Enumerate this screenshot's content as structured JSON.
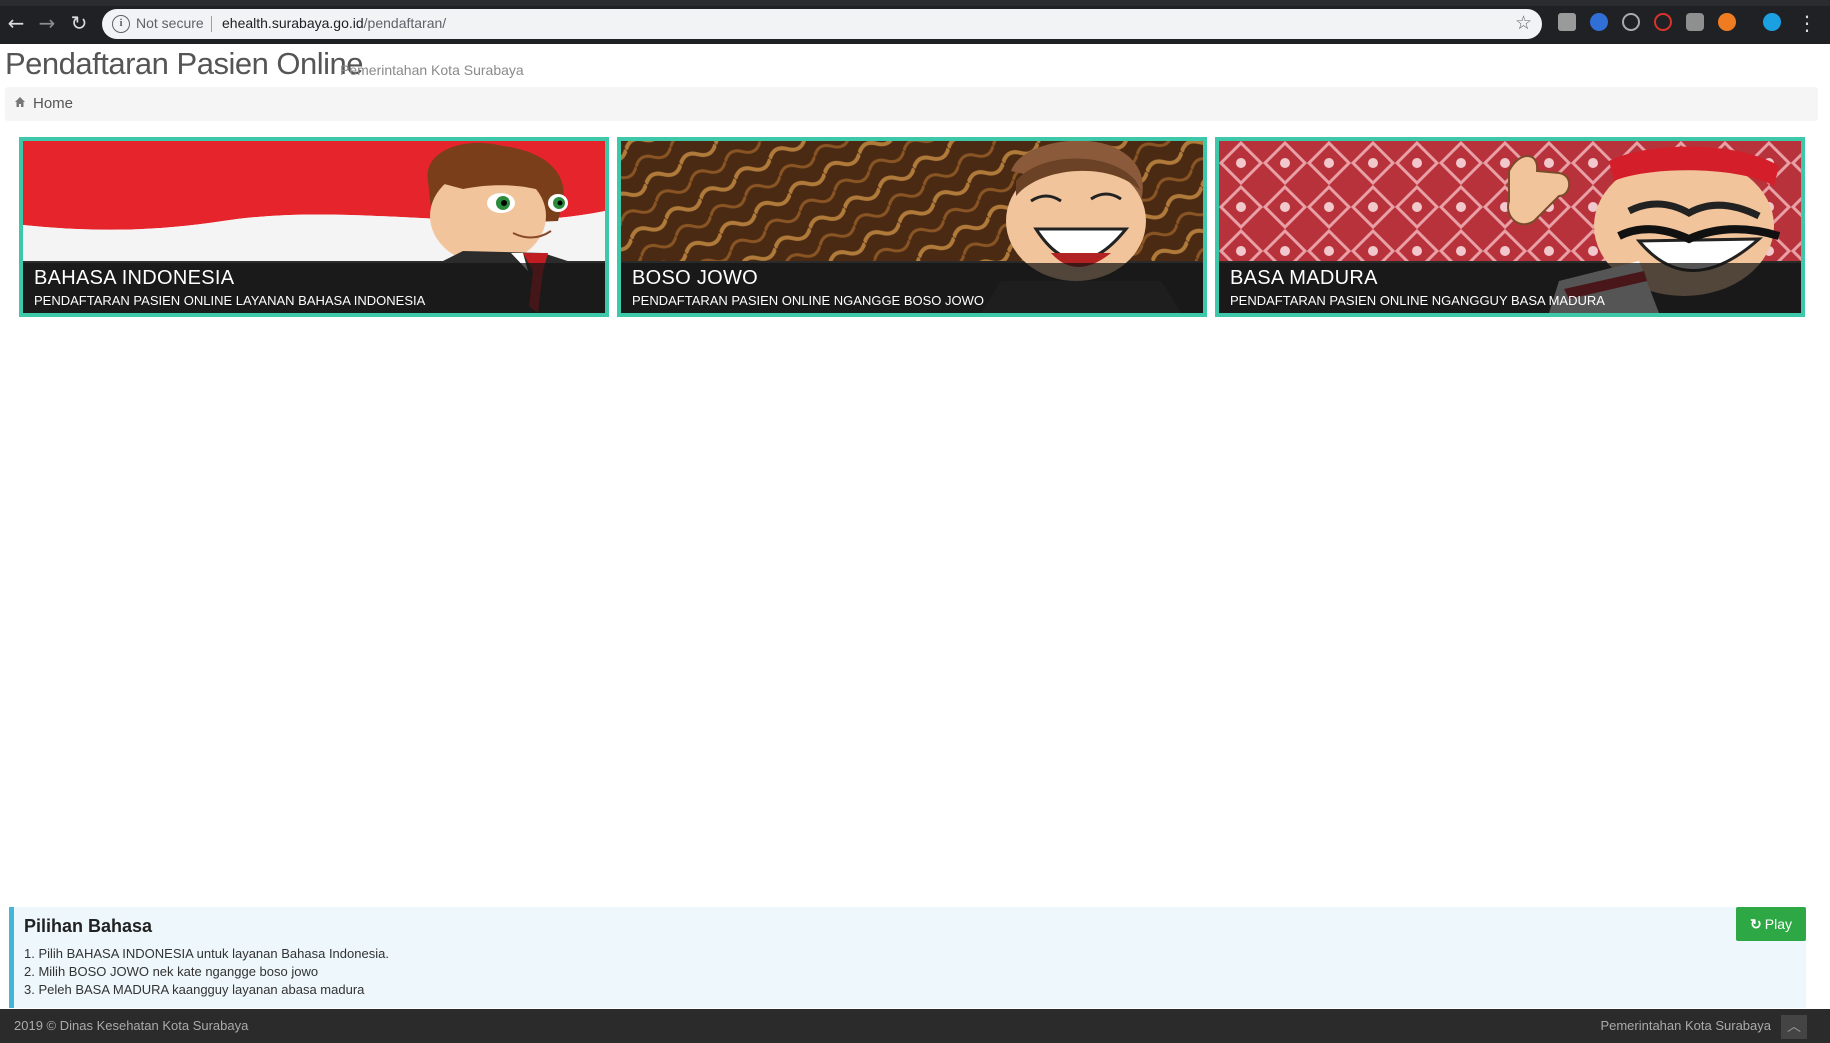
{
  "browser": {
    "security_status": "Not secure",
    "url_host": "ehealth.surabaya.go.id",
    "url_path": "/pendaftaran/",
    "back_icon": "←",
    "forward_icon": "→",
    "reload_icon": "↻",
    "bookmark_icon": "☆",
    "menu_icon": "⋮"
  },
  "header": {
    "title": "Pendaftaran Pasien Online",
    "subtitle": "Pemerintahan Kota Surabaya"
  },
  "breadcrumb": {
    "home_label": "Home"
  },
  "tiles": [
    {
      "title": "BAHASA INDONESIA",
      "subtitle": "PENDAFTARAN PASIEN ONLINE LAYANAN BAHASA INDONESIA"
    },
    {
      "title": "BOSO JOWO",
      "subtitle": "PENDAFTARAN PASIEN ONLINE NGANGGE BOSO JOWO"
    },
    {
      "title": "BASA MADURA",
      "subtitle": "PENDAFTARAN PASIEN ONLINE NGANGGUY BASA MADURA"
    }
  ],
  "info_panel": {
    "title": "Pilihan Bahasa",
    "items": [
      "1. Pilih BAHASA INDONESIA untuk layanan Bahasa Indonesia.",
      "2. Milih BOSO JOWO nek kate ngangge boso jowo",
      "3. Peleh BASA MADURA kaangguy layanan abasa madura"
    ],
    "play_label": "Play",
    "play_icon": "↻"
  },
  "footer": {
    "left": "2019 © Dinas Kesehatan Kota Surabaya",
    "right": "Pemerintahan Kota Surabaya",
    "scroll_top_icon": "︿"
  },
  "colors": {
    "tile_border": "#3dc9a9",
    "play_button": "#2ea844",
    "info_accent": "#45b6d9",
    "footer_bg": "#2b2b2b"
  }
}
